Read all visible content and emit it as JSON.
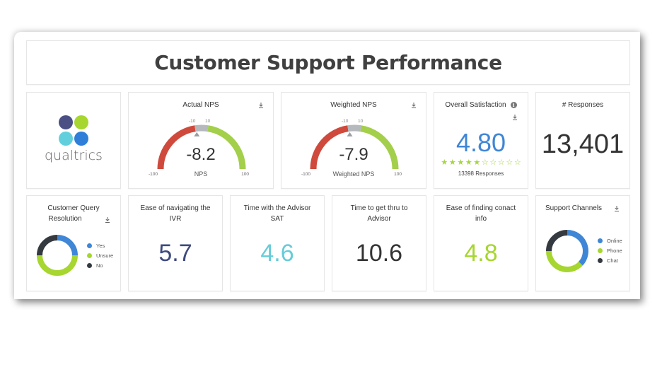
{
  "header": {
    "title": "Customer Support Performance"
  },
  "logo": {
    "text": "qualtrics",
    "colors": [
      "#4a4f84",
      "#a6d62f",
      "#62d0dc",
      "#2f7fd9"
    ]
  },
  "colors": {
    "red": "#cf4a3c",
    "green": "#a3cf4a",
    "grey": "#b5b8bd",
    "blue": "#3f86d6",
    "lime": "#a6d62f",
    "dark": "#343a40",
    "navy": "#3e4a7e",
    "teal": "#66ccd8"
  },
  "actual_nps": {
    "title": "Actual NPS",
    "value": "-8.2",
    "label": "NPS",
    "min_label": "-100",
    "max_label": "100",
    "band_low_label": "-10",
    "band_high_label": "10",
    "min": -100,
    "max": 100,
    "value_num": -8.2,
    "band_low": -10,
    "band_high": 10
  },
  "weighted_nps": {
    "title": "Weighted NPS",
    "value": "-7.9",
    "label": "Weighted NPS",
    "min_label": "-100",
    "max_label": "100",
    "band_low_label": "-10",
    "band_high_label": "10",
    "min": -100,
    "max": 100,
    "value_num": -7.9,
    "band_low": -10,
    "band_high": 10
  },
  "overall_satisfaction": {
    "title": "Overall Satisfaction",
    "info_icon": "i",
    "value": "4.80",
    "rating": 4.8,
    "star_count": 10,
    "responses_text": "13398 Responses"
  },
  "responses": {
    "title": "# Responses",
    "value": "13,401"
  },
  "query_resolution": {
    "title_line1": "Customer Query",
    "title_line2": "Resolution",
    "legend": [
      {
        "label": "Yes",
        "color": "#3f86d6",
        "share": 0.25
      },
      {
        "label": "Unsure",
        "color": "#a6d62f",
        "share": 0.5
      },
      {
        "label": "No",
        "color": "#343a40",
        "share": 0.25
      }
    ]
  },
  "ivr": {
    "title_line1": "Ease of navigating the",
    "title_line2": "IVR",
    "value": "5.7"
  },
  "advisor_sat": {
    "title_line1": "Time with the Advisor",
    "title_line2": "SAT",
    "value": "4.6"
  },
  "time_to_advisor": {
    "title_line1": "Time to get thru to",
    "title_line2": "Advisor",
    "value": "10.6"
  },
  "contact_info": {
    "title_line1": "Ease of finding conact",
    "title_line2": "info",
    "value": "4.8"
  },
  "support_channels": {
    "title": "Support Channels",
    "legend": [
      {
        "label": "Online",
        "color": "#3f86d6",
        "share": 0.37
      },
      {
        "label": "Phone",
        "color": "#a6d62f",
        "share": 0.38
      },
      {
        "label": "Chat",
        "color": "#343a40",
        "share": 0.25
      }
    ]
  }
}
